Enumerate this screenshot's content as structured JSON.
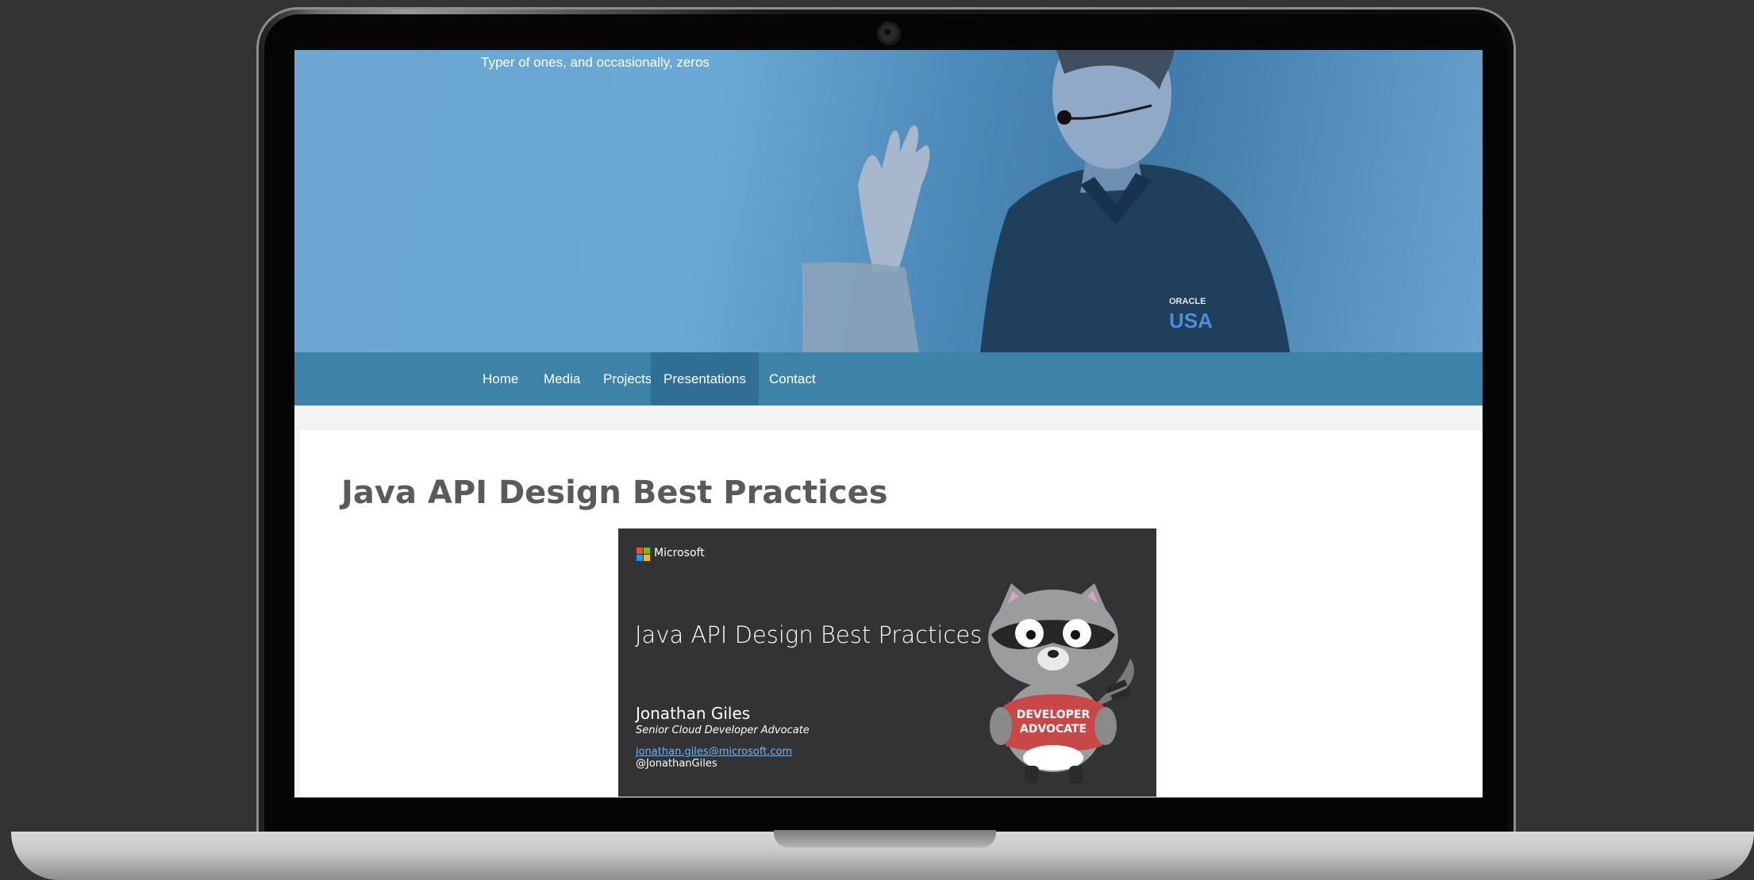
{
  "site": {
    "tagline": "Typer of ones, and occasionally, zeros"
  },
  "nav": {
    "items": [
      {
        "label": "Home"
      },
      {
        "label": "Media"
      },
      {
        "label": "Projects"
      },
      {
        "label": "Presentations",
        "active": true
      },
      {
        "label": "Contact"
      }
    ]
  },
  "page": {
    "title": "Java API Design Best Practices"
  },
  "slide": {
    "brand": "Microsoft",
    "title": "Java API Design Best Practices",
    "presenter": "Jonathan Giles",
    "role": "Senior Cloud Developer Advocate",
    "email": "jonathan.giles@microsoft.com",
    "handle": "@JonathanGiles",
    "mascot_shirt_text": "DEVELOPER ADVOCATE",
    "shirt_badge_text": "ORACLE USA"
  },
  "colors": {
    "nav_bg": "#3c83a7",
    "nav_active": "#2f6f93",
    "slide_bg": "#333335",
    "ms_red": "#f25022",
    "ms_green": "#7fba00",
    "ms_blue": "#00a4ef",
    "ms_yellow": "#ffb900"
  }
}
